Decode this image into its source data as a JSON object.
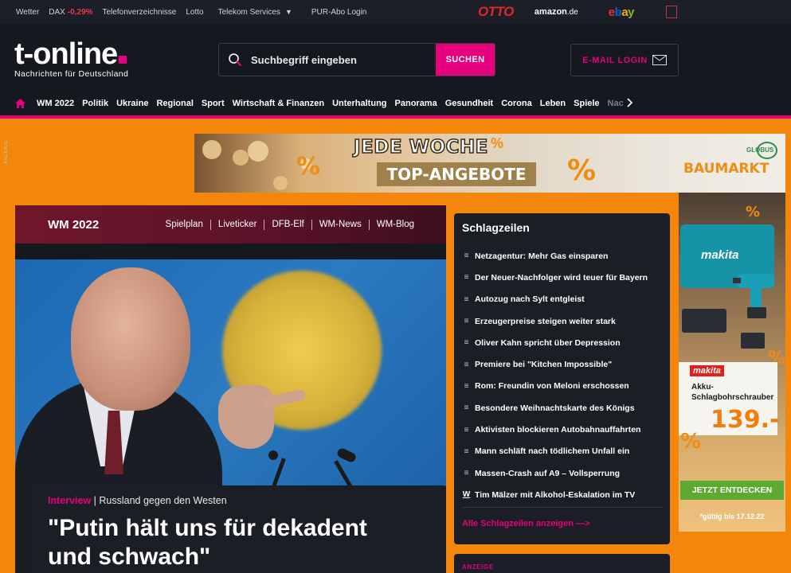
{
  "topbar": {
    "wetter": "Wetter",
    "dax_label": "DAX",
    "dax_value": "-0,29%",
    "telefon": "Telefonverzeichnisse",
    "lotto": "Lotto",
    "telekom": "Telekom Services",
    "pur": "PUR-Abo Login"
  },
  "partners": {
    "otto": "OTTO",
    "amazon": "amazon",
    "amazon_tld": ".de",
    "ebay": [
      "e",
      "b",
      "a",
      "y"
    ]
  },
  "header": {
    "logo_word": "t-online",
    "logo_tagline": "Nachrichten für Deutschland",
    "search_placeholder": "Suchbegriff eingeben",
    "search_button": "SUCHEN",
    "email_login": "E-MAIL LOGIN"
  },
  "nav": {
    "items": [
      "WM 2022",
      "Politik",
      "Ukraine",
      "Regional",
      "Sport",
      "Wirtschaft & Finanzen",
      "Unterhaltung",
      "Panorama",
      "Gesundheit",
      "Corona",
      "Leben",
      "Spiele"
    ],
    "faded": "Nac"
  },
  "ad_banner": {
    "anzeige_label": "ANZEIGE",
    "line1": "JEDE WOCHE",
    "line2": "TOP-ANGEBOTE",
    "pct": "%",
    "brand": "BAUMARKT",
    "brand_top": "GLOBUS"
  },
  "skyscraper": {
    "case_brand": "makita",
    "brand": "makita",
    "product": "Akku-Schlagbohrschrauber",
    "price": "139.-",
    "cta": "JETZT ENTDECKEN",
    "validity": "*gültig bis 17.12.22",
    "pct": "%"
  },
  "wm": {
    "title": "WM 2022",
    "links": [
      "Spielplan",
      "Liveticker",
      "DFB-Elf",
      "WM-News",
      "WM-Blog"
    ]
  },
  "hero": {
    "kicker_tag": "Interview",
    "kicker_sep": " | ",
    "kicker_text": "Russland gegen den Westen",
    "headline": "\"Putin hält uns für dekadent und schwach\""
  },
  "schlagzeilen": {
    "title": "Schlagzeilen",
    "items": [
      {
        "icon": "list-icon",
        "text": "Netzagentur: Mehr Gas einsparen"
      },
      {
        "icon": "list-icon",
        "text": "Der Neuer-Nachfolger wird teuer für Bayern"
      },
      {
        "icon": "list-icon",
        "text": "Autozug nach Sylt entgleist"
      },
      {
        "icon": "list-icon",
        "text": "Erzeugerpreise steigen weiter stark"
      },
      {
        "icon": "list-icon",
        "text": "Oliver Kahn spricht über Depression"
      },
      {
        "icon": "list-icon",
        "text": "Premiere bei \"Kitchen Impossible\""
      },
      {
        "icon": "list-icon",
        "text": "Rom: Freundin von Meloni erschossen"
      },
      {
        "icon": "list-icon",
        "text": "Besondere Weihnachtskarte des Königs"
      },
      {
        "icon": "list-icon",
        "text": "Aktivisten blockieren Autobahnauffahrten"
      },
      {
        "icon": "list-icon",
        "text": "Mann schläft nach tödlichem Unfall ein"
      },
      {
        "icon": "list-icon",
        "text": "Massen-Crash auf A9 – Vollsperrung"
      },
      {
        "icon": "w-icon",
        "text": "Tim Mälzer mit Alkohol-Eskalation im TV"
      }
    ],
    "all_link": "Alle Schlagzeilen anzeigen",
    "all_arrow": "—>"
  },
  "anzeige2": "ANZEIGE",
  "colors": {
    "magenta": "#e5007d",
    "dark": "#16181f",
    "orange_bg": "#f3860b"
  }
}
